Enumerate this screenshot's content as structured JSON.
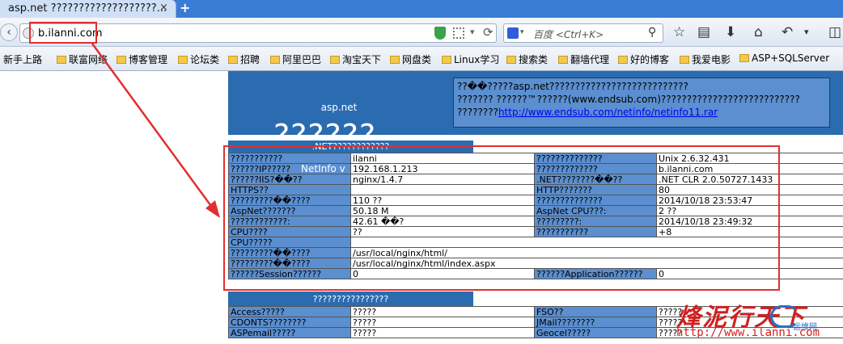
{
  "tab": {
    "title": "asp.net ???????????????????...",
    "close": "×",
    "new": "+"
  },
  "nav": {
    "back": "‹",
    "url": "b.ilanni.com",
    "dropdown": "▾",
    "reload": "⟳",
    "search_placeholder": "百度 <Ctrl+K>",
    "search_dropdown": "▾",
    "search_icon": "⚲",
    "icons": [
      "star-icon",
      "reading-list-icon",
      "download-icon",
      "home-icon",
      "undo-icon",
      "dropdown-icon",
      "puzzle-icon"
    ]
  },
  "bookmarks": [
    "新手上路",
    "联富网络",
    "博客管理",
    "论坛类",
    "招聘",
    "阿里巴巴",
    "淘宝天下",
    "网盘类",
    "Linux学习",
    "搜索类",
    "翻墙代理",
    "好的博客",
    "我爱电影",
    "ASP+SQLServer"
  ],
  "page": {
    "header_title": "asp.net",
    "info_lines": [
      "??��?????asp.net???????????????????????????",
      "??????? ??????™??????(www.endsub.com)???????????????????????????",
      "????????"
    ],
    "info_link": "http://www.endsub.com/netinfo/netinfo11.rar",
    "big_title": "??????",
    "section1_title": ".NET????????????",
    "netinfo_label": "NetInfo v",
    "section2_title": "????????????????",
    "rows": [
      [
        "???????????",
        "ilanni",
        "??????????????",
        "Unix 2.6.32.431"
      ],
      [
        "??????IP?????",
        "192.168.1.213",
        "?????????????",
        "b.ilanni.com"
      ],
      [
        "??????IIS?��??",
        "nginx/1.4.7",
        ".NET????????��??",
        ".NET CLR 2.0.50727.1433"
      ],
      [
        "HTTPS??",
        "",
        "HTTP???????",
        "80"
      ],
      [
        "?????????��????",
        "110 ??",
        "??????????????",
        "2014/10/18 23:53:47"
      ],
      [
        "AspNet???????",
        "50.18 M",
        "AspNet CPU???:",
        "2 ??"
      ],
      [
        "????????????:",
        "42.61 ��?",
        "?????????:",
        "2014/10/18 23:49:32"
      ],
      [
        "CPU????",
        "??",
        "???????????",
        "+8"
      ]
    ],
    "full_rows": [
      [
        "CPU?????",
        ""
      ],
      [
        "?????????��????",
        "/usr/local/nginx/html/"
      ],
      [
        "?????????��????",
        "/usr/local/nginx/html/index.aspx"
      ]
    ],
    "session_row": [
      "??????Session??????",
      "0",
      "??????Application??????",
      "0"
    ],
    "comp_rows": [
      [
        "Access?????",
        "?????",
        "FSO??",
        "?????"
      ],
      [
        "CDONTS????????",
        "?????",
        "JMail????????",
        "?????"
      ],
      [
        "ASPemail?????",
        "?????",
        "Geocel?????",
        "?????"
      ]
    ]
  },
  "watermark": {
    "text": "烽泥行天下",
    "url": "http://www.ilanni.com",
    "logo_text": "运维网"
  },
  "colors": {
    "accent": "#2b6cb0",
    "cell_label": "#5b8fd0",
    "annotation": "#e03030"
  }
}
